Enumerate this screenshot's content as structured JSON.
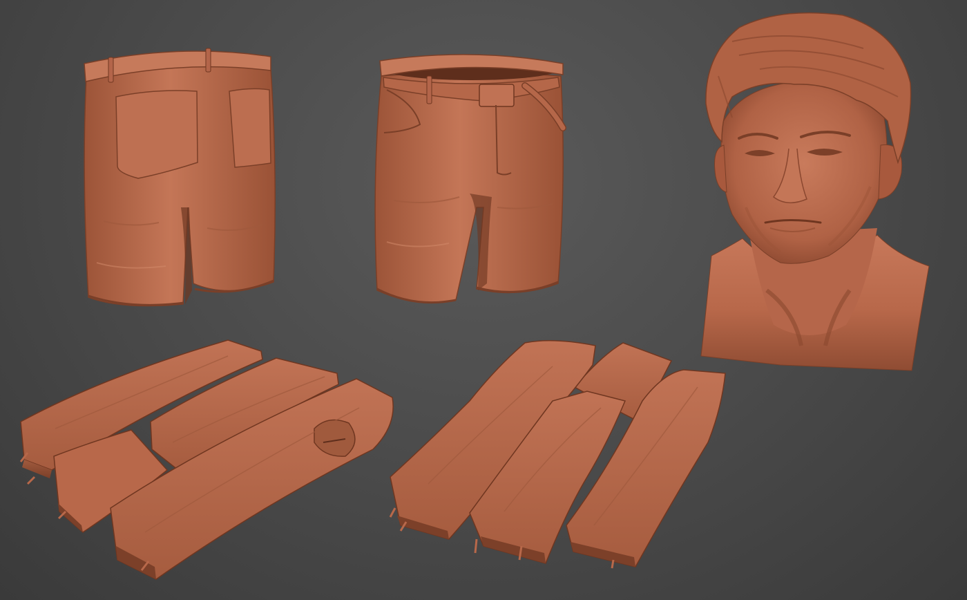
{
  "scene": {
    "background_color": "#4c4c4c",
    "clay_color": "#b8684a",
    "clay_highlight": "#d08a68",
    "clay_shadow": "#7a3f28",
    "objects": [
      "shorts-back-view",
      "shorts-front-view",
      "male-head-bust",
      "wood-planks-set-left",
      "wood-planks-set-right"
    ]
  }
}
